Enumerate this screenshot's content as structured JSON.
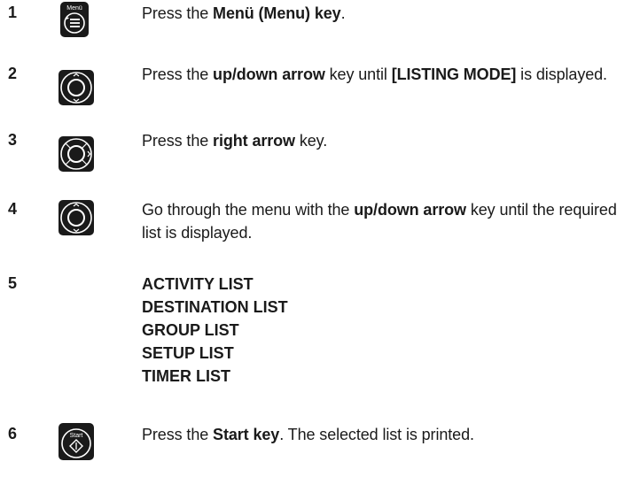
{
  "steps": [
    {
      "number": "1",
      "icon": "menu-key-icon",
      "icon_label": "Menü",
      "parts": [
        {
          "t": "Press the ",
          "b": false
        },
        {
          "t": "Menü (Menu) key",
          "b": true
        },
        {
          "t": ".",
          "b": false
        }
      ]
    },
    {
      "number": "2",
      "icon": "up-down-arrow-key-icon",
      "parts": [
        {
          "t": "Press the ",
          "b": false
        },
        {
          "t": "up/down arrow",
          "b": true
        },
        {
          "t": " key until ",
          "b": false
        },
        {
          "t": "[LISTING MODE]",
          "b": true
        },
        {
          "t": " is displayed.",
          "b": false
        }
      ]
    },
    {
      "number": "3",
      "icon": "right-arrow-key-icon",
      "parts": [
        {
          "t": "Press the ",
          "b": false
        },
        {
          "t": "right arrow",
          "b": true
        },
        {
          "t": " key.",
          "b": false
        }
      ]
    },
    {
      "number": "4",
      "icon": "up-down-arrow-key-icon",
      "parts": [
        {
          "t": "Go through the menu with the ",
          "b": false
        },
        {
          "t": "up/down arrow",
          "b": true
        },
        {
          "t": " key until the required list is displayed.",
          "b": false
        }
      ]
    },
    {
      "number": "5",
      "list": [
        "ACTIVITY LIST",
        "DESTINATION LIST",
        "GROUP LIST",
        "SETUP LIST",
        "TIMER LIST"
      ]
    },
    {
      "number": "6",
      "icon": "start-key-icon",
      "icon_label": "Start",
      "parts": [
        {
          "t": "Press the ",
          "b": false
        },
        {
          "t": "Start key",
          "b": true
        },
        {
          "t": ". The selected list is printed.",
          "b": false
        }
      ]
    }
  ],
  "colors": {
    "text": "#1a1a1a",
    "key_fill": "#1a1a1a",
    "key_white": "#ffffff"
  }
}
